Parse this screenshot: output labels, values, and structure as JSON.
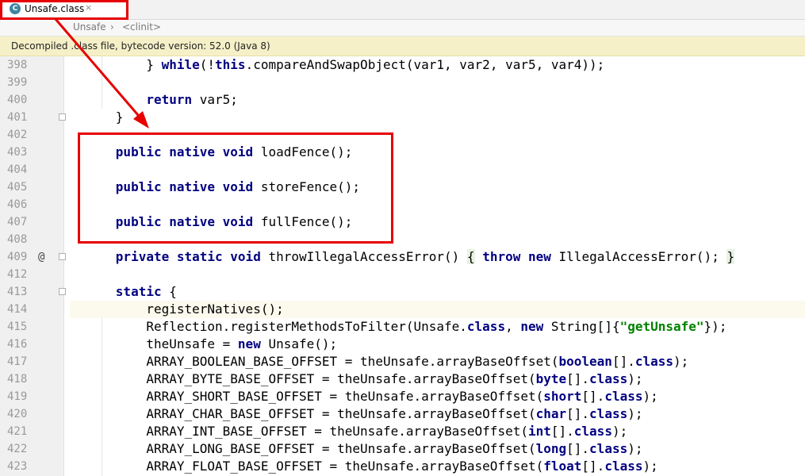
{
  "tab": {
    "label": "Unsafe.class",
    "icon": "C",
    "close": "×"
  },
  "breadcrumb": {
    "items": [
      "Unsafe",
      "<clinit>"
    ],
    "separator": "›"
  },
  "infobar": {
    "text": "Decompiled .class file, bytecode version: 52.0 (Java 8)"
  },
  "colors": {
    "keyword": "#000080",
    "string": "#008000",
    "annotation": "#e60000"
  },
  "lines": [
    {
      "n": "398",
      "indent": 10,
      "parts": [
        [
          "p",
          "} "
        ],
        [
          "k",
          "while"
        ],
        [
          "p",
          "(!"
        ],
        [
          "k",
          "this"
        ],
        [
          "p",
          ".compareAndSwapObject(var1, var2, var5, var4));"
        ]
      ]
    },
    {
      "n": "399",
      "indent": 0,
      "parts": []
    },
    {
      "n": "400",
      "indent": 10,
      "parts": [
        [
          "k",
          "return"
        ],
        [
          "p",
          " var5;"
        ]
      ]
    },
    {
      "n": "401",
      "indent": 6,
      "parts": [
        [
          "p",
          "}"
        ]
      ],
      "fold": true
    },
    {
      "n": "402",
      "indent": 0,
      "parts": []
    },
    {
      "n": "403",
      "indent": 6,
      "parts": [
        [
          "k",
          "public native void"
        ],
        [
          "p",
          " loadFence();"
        ]
      ]
    },
    {
      "n": "404",
      "indent": 0,
      "parts": []
    },
    {
      "n": "405",
      "indent": 6,
      "parts": [
        [
          "k",
          "public native void"
        ],
        [
          "p",
          " storeFence();"
        ]
      ]
    },
    {
      "n": "406",
      "indent": 0,
      "parts": []
    },
    {
      "n": "407",
      "indent": 6,
      "parts": [
        [
          "k",
          "public native void"
        ],
        [
          "p",
          " fullFence();"
        ]
      ]
    },
    {
      "n": "408",
      "indent": 0,
      "parts": []
    },
    {
      "n": "409",
      "indent": 6,
      "parts": [
        [
          "k",
          "private static void"
        ],
        [
          "p",
          " throwIllegalAccessError() "
        ],
        [
          "b",
          "{"
        ],
        [
          "p",
          " "
        ],
        [
          "k",
          "throw new"
        ],
        [
          "p",
          " IllegalAccessError(); "
        ],
        [
          "b",
          "}"
        ]
      ],
      "fold": true,
      "at": "@"
    },
    {
      "n": "412",
      "indent": 0,
      "parts": []
    },
    {
      "n": "413",
      "indent": 6,
      "parts": [
        [
          "k",
          "static"
        ],
        [
          "p",
          " {"
        ]
      ],
      "fold": true
    },
    {
      "n": "414",
      "indent": 10,
      "parts": [
        [
          "p",
          "registerNatives();"
        ]
      ],
      "current": true
    },
    {
      "n": "415",
      "indent": 10,
      "parts": [
        [
          "p",
          "Reflection.registerMethodsToFilter(Unsafe."
        ],
        [
          "k",
          "class"
        ],
        [
          "p",
          ", "
        ],
        [
          "k",
          "new"
        ],
        [
          "p",
          " String[]{"
        ],
        [
          "s",
          "\"getUnsafe\""
        ],
        [
          "p",
          "});"
        ]
      ]
    },
    {
      "n": "416",
      "indent": 10,
      "parts": [
        [
          "p",
          "theUnsafe = "
        ],
        [
          "k",
          "new"
        ],
        [
          "p",
          " Unsafe();"
        ]
      ]
    },
    {
      "n": "417",
      "indent": 10,
      "parts": [
        [
          "p",
          "ARRAY_BOOLEAN_BASE_OFFSET = theUnsafe.arrayBaseOffset("
        ],
        [
          "k",
          "boolean"
        ],
        [
          "p",
          "[]."
        ],
        [
          "k",
          "class"
        ],
        [
          "p",
          ");"
        ]
      ]
    },
    {
      "n": "418",
      "indent": 10,
      "parts": [
        [
          "p",
          "ARRAY_BYTE_BASE_OFFSET = theUnsafe.arrayBaseOffset("
        ],
        [
          "k",
          "byte"
        ],
        [
          "p",
          "[]."
        ],
        [
          "k",
          "class"
        ],
        [
          "p",
          ");"
        ]
      ]
    },
    {
      "n": "419",
      "indent": 10,
      "parts": [
        [
          "p",
          "ARRAY_SHORT_BASE_OFFSET = theUnsafe.arrayBaseOffset("
        ],
        [
          "k",
          "short"
        ],
        [
          "p",
          "[]."
        ],
        [
          "k",
          "class"
        ],
        [
          "p",
          ");"
        ]
      ]
    },
    {
      "n": "420",
      "indent": 10,
      "parts": [
        [
          "p",
          "ARRAY_CHAR_BASE_OFFSET = theUnsafe.arrayBaseOffset("
        ],
        [
          "k",
          "char"
        ],
        [
          "p",
          "[]."
        ],
        [
          "k",
          "class"
        ],
        [
          "p",
          ");"
        ]
      ]
    },
    {
      "n": "421",
      "indent": 10,
      "parts": [
        [
          "p",
          "ARRAY_INT_BASE_OFFSET = theUnsafe.arrayBaseOffset("
        ],
        [
          "k",
          "int"
        ],
        [
          "p",
          "[]."
        ],
        [
          "k",
          "class"
        ],
        [
          "p",
          ");"
        ]
      ]
    },
    {
      "n": "422",
      "indent": 10,
      "parts": [
        [
          "p",
          "ARRAY_LONG_BASE_OFFSET = theUnsafe.arrayBaseOffset("
        ],
        [
          "k",
          "long"
        ],
        [
          "p",
          "[]."
        ],
        [
          "k",
          "class"
        ],
        [
          "p",
          ");"
        ]
      ]
    },
    {
      "n": "423",
      "indent": 10,
      "parts": [
        [
          "p",
          "ARRAY_FLOAT_BASE_OFFSET = theUnsafe.arrayBaseOffset("
        ],
        [
          "k",
          "float"
        ],
        [
          "p",
          "[]."
        ],
        [
          "k",
          "class"
        ],
        [
          "p",
          ");"
        ]
      ]
    }
  ]
}
